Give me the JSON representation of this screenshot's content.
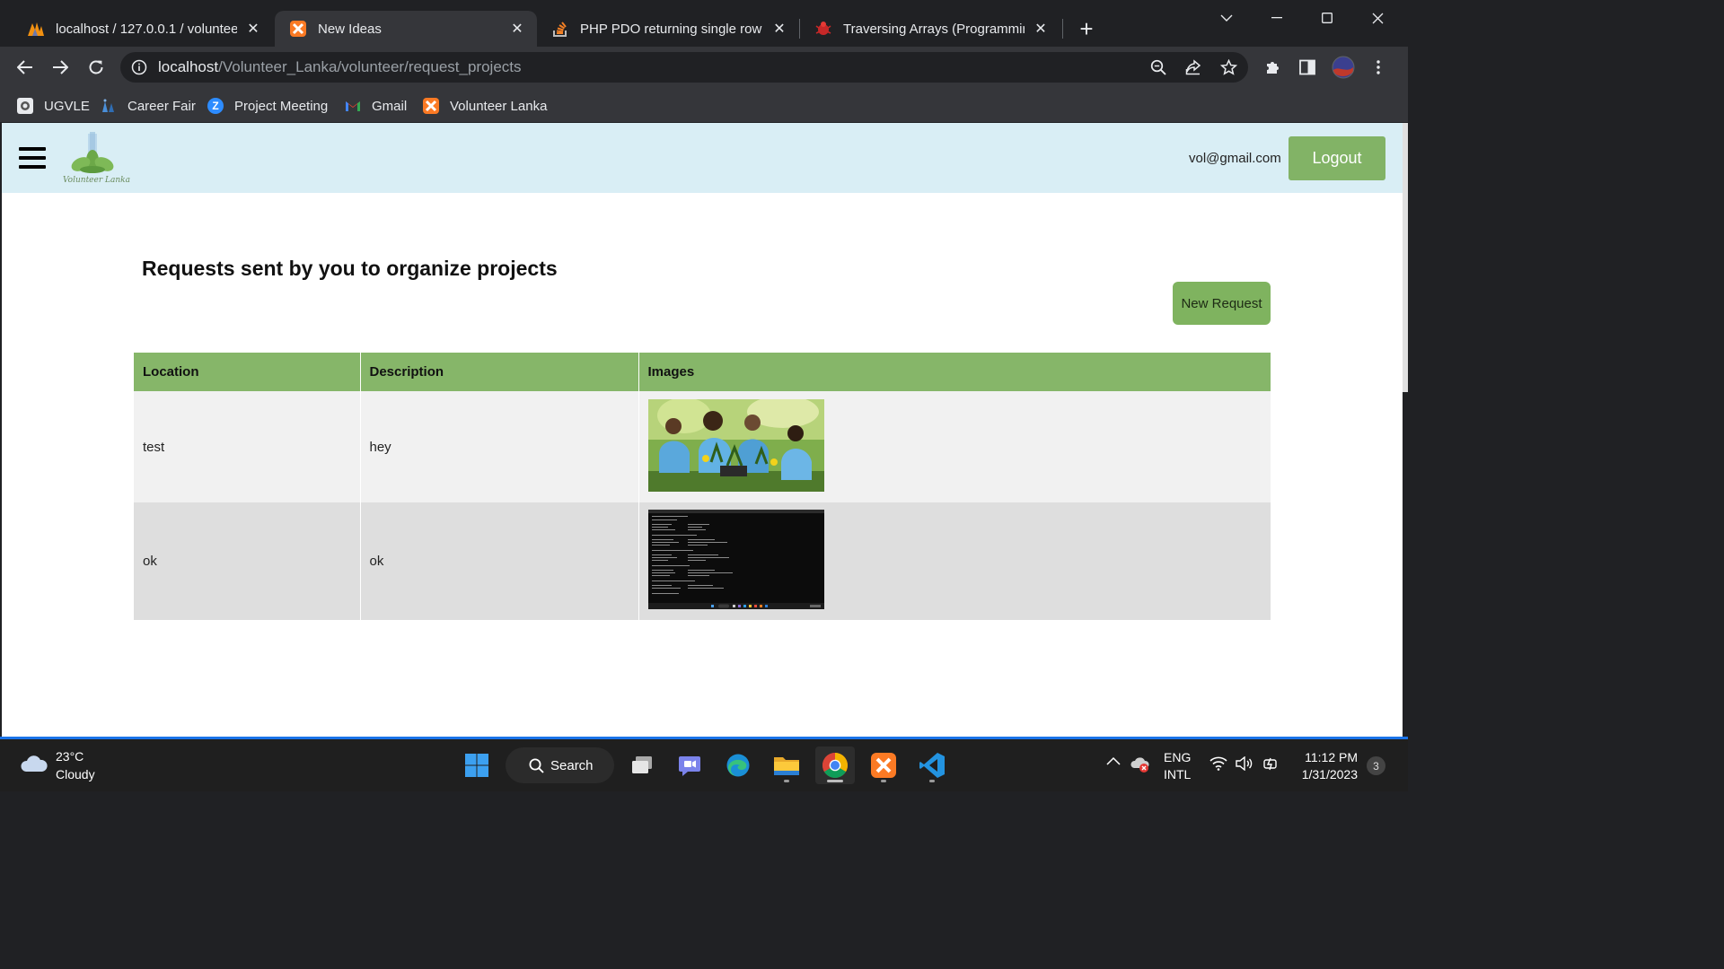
{
  "browser": {
    "tabs": [
      {
        "title": "localhost / 127.0.0.1 / volunteer_l",
        "icon": "phpmyadmin-icon",
        "active": false
      },
      {
        "title": "New Ideas",
        "icon": "xampp-icon",
        "active": true
      },
      {
        "title": "PHP PDO returning single row - S",
        "icon": "stackoverflow-icon",
        "active": false
      },
      {
        "title": "Traversing Arrays (Programming",
        "icon": "bug-icon",
        "active": false
      }
    ],
    "url_host": "localhost",
    "url_path": "/Volunteer_Lanka/volunteer/request_projects",
    "bookmarks": [
      {
        "label": "UGVLE",
        "icon": "ugvle-icon"
      },
      {
        "label": "Career Fair",
        "icon": "career-fair-icon"
      },
      {
        "label": "Project Meeting",
        "icon": "zoom-icon"
      },
      {
        "label": "Gmail",
        "icon": "gmail-icon"
      },
      {
        "label": "Volunteer Lanka",
        "icon": "xampp-icon"
      }
    ]
  },
  "site": {
    "logo_text": "Volunteer Lanka",
    "user_email": "vol@gmail.com",
    "logout_label": "Logout",
    "accent_color": "#82b366",
    "header_bg": "#d9eef5"
  },
  "page": {
    "title": "Requests sent by you to organize projects",
    "new_request_label": "New Request",
    "table": {
      "headers": [
        "Location",
        "Description",
        "Images"
      ],
      "rows": [
        {
          "location": "test",
          "description": "hey",
          "image": "volunteers-planting-photo"
        },
        {
          "location": "ok",
          "description": "ok",
          "image": "terminal-screenshot"
        }
      ]
    }
  },
  "taskbar": {
    "weather_temp": "23°C",
    "weather_desc": "Cloudy",
    "search_label": "Search",
    "lang_1": "ENG",
    "lang_2": "INTL",
    "time": "11:12 PM",
    "date": "1/31/2023",
    "notification_count": "3"
  }
}
